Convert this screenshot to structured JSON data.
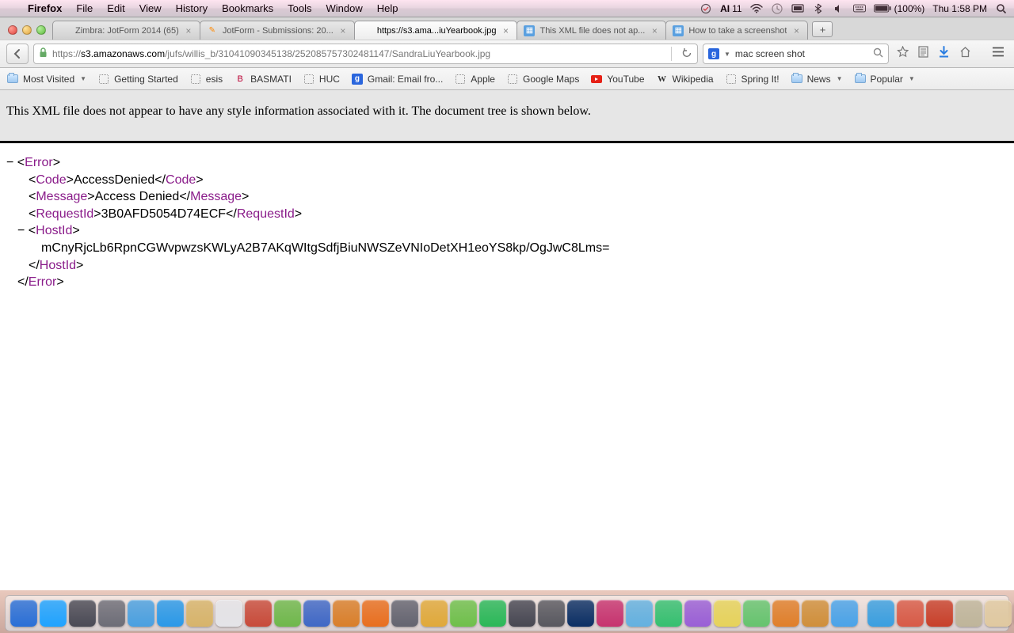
{
  "menubar": {
    "app": "Firefox",
    "items": [
      "File",
      "Edit",
      "View",
      "History",
      "Bookmarks",
      "Tools",
      "Window",
      "Help"
    ],
    "adobe": "11",
    "battery": "(100%)",
    "clock": "Thu 1:58 PM"
  },
  "tabs": [
    {
      "title": "Zimbra: JotForm 2014 (65)",
      "favicon": "generic"
    },
    {
      "title": "JotForm - Submissions: 20...",
      "favicon": "jotform"
    },
    {
      "title": "https://s3.ama...iuYearbook.jpg",
      "favicon": "none",
      "active": true
    },
    {
      "title": "This XML file does not ap...",
      "favicon": "img"
    },
    {
      "title": "How to take a screenshot",
      "favicon": "img"
    }
  ],
  "url": {
    "host": "s3.amazonaws.com",
    "path": "/jufs/willis_b/31041090345138/252085757302481147/SandraLiuYearbook.jpg",
    "prefix": "https://"
  },
  "search": {
    "value": "mac screen shot"
  },
  "bookmarks": [
    {
      "label": "Most Visited",
      "icon": "folder",
      "dd": true
    },
    {
      "label": "Getting Started",
      "icon": "dotted"
    },
    {
      "label": "esis",
      "icon": "dotted"
    },
    {
      "label": "BASMATI",
      "icon": "b"
    },
    {
      "label": "HUC",
      "icon": "dotted"
    },
    {
      "label": "Gmail: Email fro...",
      "icon": "g"
    },
    {
      "label": "Apple",
      "icon": "dotted"
    },
    {
      "label": "Google Maps",
      "icon": "dotted"
    },
    {
      "label": "YouTube",
      "icon": "yt"
    },
    {
      "label": "Wikipedia",
      "icon": "w"
    },
    {
      "label": "Spring It!",
      "icon": "dotted"
    },
    {
      "label": "News",
      "icon": "folder",
      "dd": true
    },
    {
      "label": "Popular",
      "icon": "folder",
      "dd": true
    }
  ],
  "xml": {
    "banner": "This XML file does not appear to have any style information associated with it. The document tree is shown below.",
    "error_open": "Error",
    "code_tag": "Code",
    "code_val": "AccessDenied",
    "message_tag": "Message",
    "message_val": "Access Denied",
    "requestid_tag": "RequestId",
    "requestid_val": "3B0AFD5054D74ECF",
    "hostid_tag": "HostId",
    "hostid_val": "mCnyRjcLb6RpnCGWvpwzsKWLyA2B7AKqWItgSdfjBiuNWSZeVNIoDetXH1eoYS8kp/OgJwC8Lms="
  },
  "dock_colors": [
    "#2a6fd6",
    "#1fa3ff",
    "#4a4a55",
    "#6d6d77",
    "#4aa0e0",
    "#2a99e8",
    "#d7b46a",
    "#e4e4e8",
    "#c84b3a",
    "#6fb84b",
    "#3f68c6",
    "#d97f2a",
    "#e86f1f",
    "#646470",
    "#e0a93a",
    "#6fc04b",
    "#2ab858",
    "#474752",
    "#58585f",
    "#0b2f64",
    "#c7336f",
    "#63b1e0",
    "#35c070",
    "#9a5fd6",
    "#e6d35a",
    "#66c46e",
    "#e07f2a",
    "#d08f3a",
    "#4aa3e8",
    "#3a9fe0",
    "#d85a46",
    "#c8402a",
    "#bfb59a",
    "#e0c9a0",
    "#e4e4e8",
    "#e4e4e8",
    "#e4e4e8",
    "#e4e4e8",
    "#c8c8cf",
    "#5a5a62"
  ]
}
